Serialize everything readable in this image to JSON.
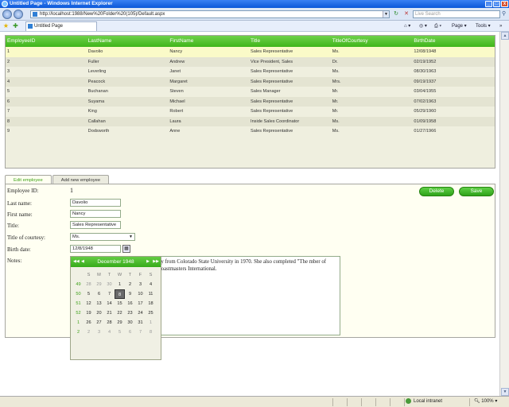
{
  "window": {
    "title": "Untitled Page - Windows Internet Explorer",
    "min": "_",
    "max": "□",
    "close": "x"
  },
  "address": {
    "url": "http://localhost:1988/New%20Folder%20(105)/Default.aspx",
    "search_placeholder": "Live Search"
  },
  "browser_tab": {
    "label": "Untitled Page"
  },
  "commands": {
    "page": "Page ▾",
    "tools": "Tools ▾",
    "more": "»"
  },
  "grid": {
    "columns": [
      "EmployeeID",
      "LastName",
      "FirstName",
      "Title",
      "TitleOfCourtesy",
      "BirthDate"
    ],
    "rows": [
      [
        "1",
        "Davolio",
        "Nancy",
        "Sales Representative",
        "Ms.",
        "12/08/1948"
      ],
      [
        "2",
        "Fuller",
        "Andrew",
        "Vice President, Sales",
        "Dr.",
        "02/19/1952"
      ],
      [
        "3",
        "Leverling",
        "Janet",
        "Sales Representative",
        "Ms.",
        "08/30/1963"
      ],
      [
        "4",
        "Peacock",
        "Margaret",
        "Sales Representative",
        "Mrs.",
        "09/19/1937"
      ],
      [
        "5",
        "Buchanan",
        "Steven",
        "Sales Manager",
        "Mr.",
        "03/04/1955"
      ],
      [
        "6",
        "Suyama",
        "Michael",
        "Sales Representative",
        "Mr.",
        "07/02/1963"
      ],
      [
        "7",
        "King",
        "Robert",
        "Sales Representative",
        "Mr.",
        "05/29/1960"
      ],
      [
        "8",
        "Callahan",
        "Laura",
        "Inside Sales Coordinator",
        "Ms.",
        "01/09/1958"
      ],
      [
        "9",
        "Dodsworth",
        "Anne",
        "Sales Representative",
        "Ms.",
        "01/27/1966"
      ]
    ]
  },
  "tabs": {
    "edit": "Edit employee",
    "add": "Add new employee"
  },
  "form": {
    "employee_id_label": "Employee ID:",
    "employee_id_value": "1",
    "last_name_label": "Last name:",
    "last_name_value": "Davolio",
    "first_name_label": "First name:",
    "first_name_value": "Nancy",
    "title_label": "Title:",
    "title_value": "Sales Representative",
    "courtesy_label": "Title of courtesy:",
    "courtesy_value": "Ms.",
    "birth_label": "Birth date:",
    "birth_value": "12/8/1948",
    "notes_label": "Notes:",
    "notes_text": "gy from Colorado State University in 1970. She also completed \"The mber of Toastmasters International.",
    "delete_label": "Delete",
    "save_label": "Save"
  },
  "calendar": {
    "month_label": "December 1948",
    "nav_prev_year": "◀◀",
    "nav_prev": "◀",
    "nav_next": "▶",
    "nav_next_year": "▶▶",
    "day_names": [
      "",
      "S",
      "M",
      "T",
      "W",
      "T",
      "F",
      "S"
    ],
    "weeks": [
      {
        "wk": "49",
        "days": [
          "28",
          "29",
          "30",
          "1",
          "2",
          "3",
          "4"
        ]
      },
      {
        "wk": "50",
        "days": [
          "5",
          "6",
          "7",
          "8",
          "9",
          "10",
          "11"
        ]
      },
      {
        "wk": "51",
        "days": [
          "12",
          "13",
          "14",
          "15",
          "16",
          "17",
          "18"
        ]
      },
      {
        "wk": "52",
        "days": [
          "19",
          "20",
          "21",
          "22",
          "23",
          "24",
          "25"
        ]
      },
      {
        "wk": "1",
        "days": [
          "26",
          "27",
          "28",
          "29",
          "30",
          "31",
          "1"
        ]
      },
      {
        "wk": "2",
        "days": [
          "2",
          "3",
          "4",
          "5",
          "6",
          "7",
          "8"
        ]
      }
    ],
    "selected_day": "8"
  },
  "status": {
    "zone": "Local intranet",
    "zoom": "100%"
  },
  "colors": {
    "accent_green": "#3fb51a",
    "grid_bg": "#efefdf",
    "panel_bg": "#fffff2"
  }
}
